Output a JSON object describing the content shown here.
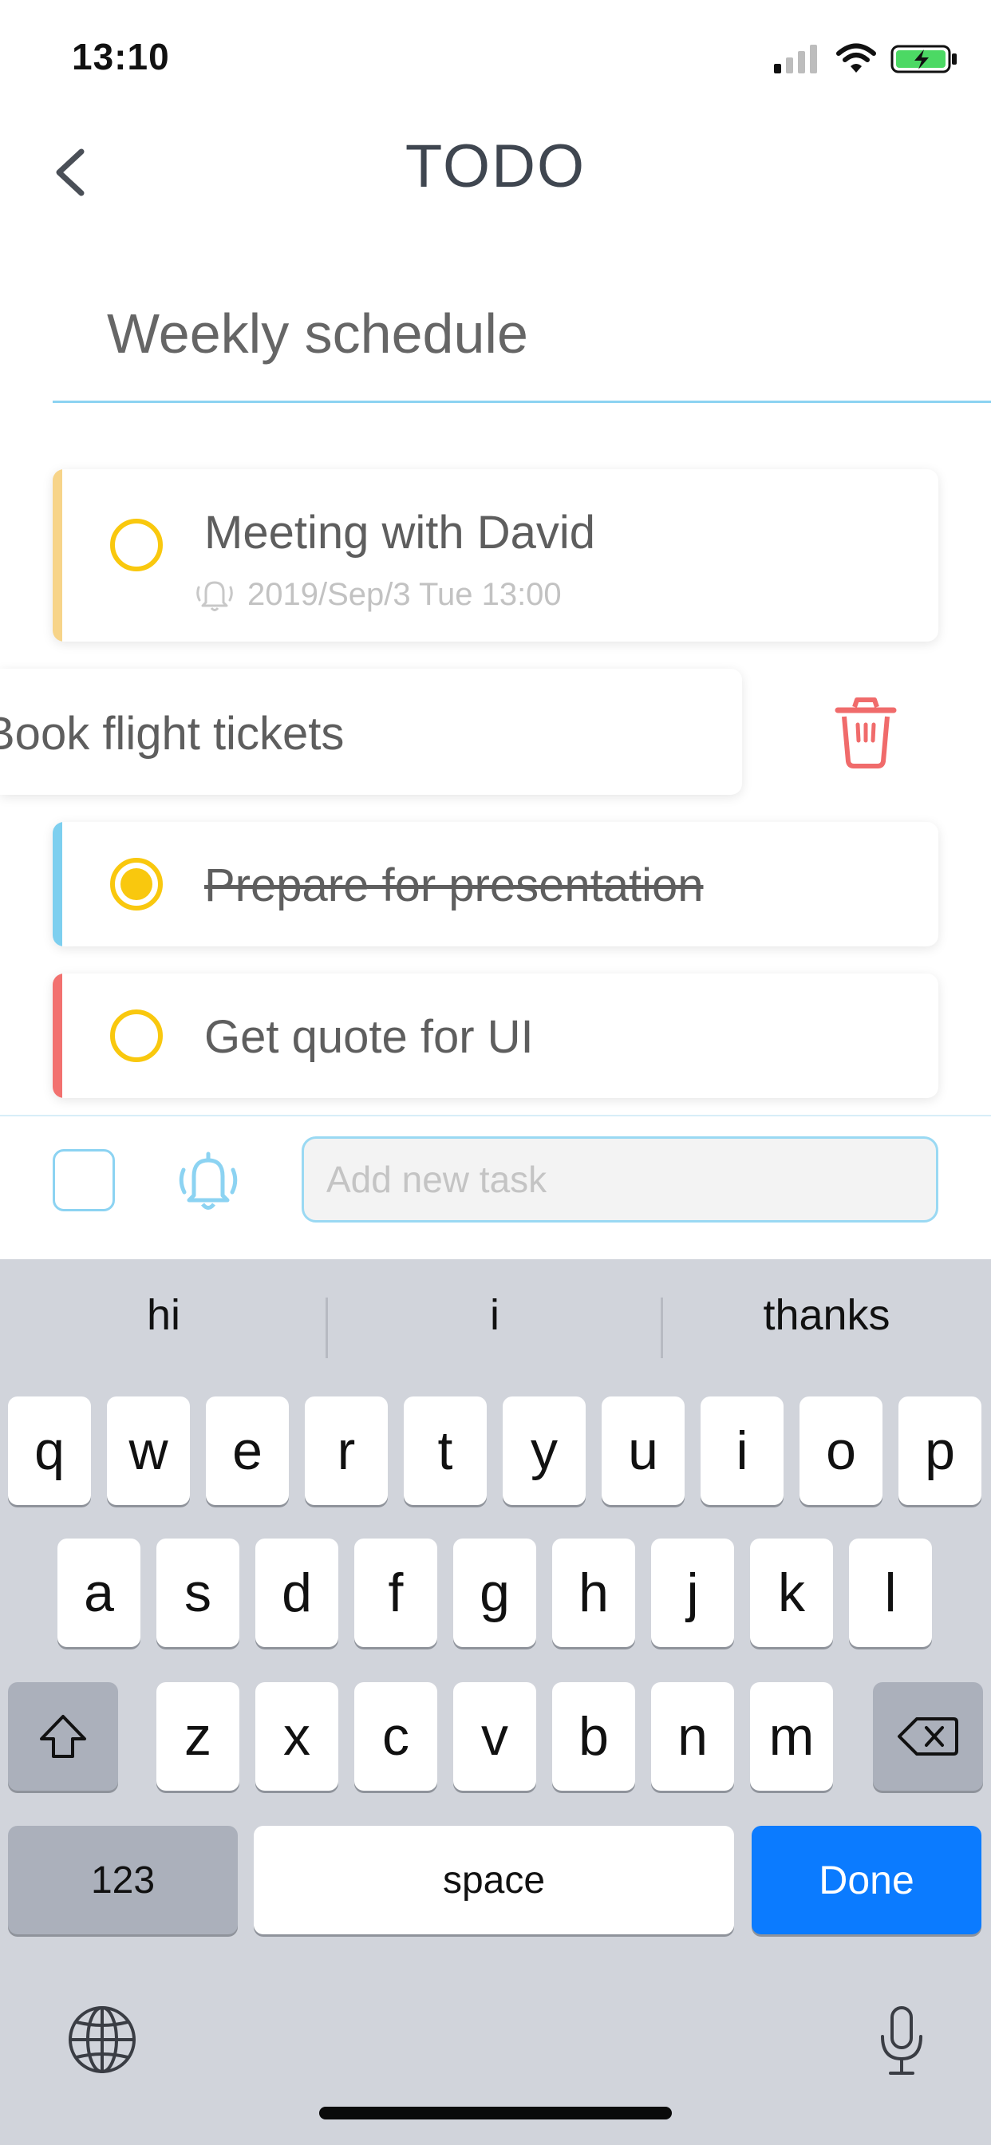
{
  "status_bar": {
    "time": "13:10"
  },
  "nav": {
    "title": "TODO"
  },
  "list": {
    "title": "Weekly schedule"
  },
  "tasks": [
    {
      "text": "Meeting with David",
      "reminder": "2019/Sep/3 Tue 13:00",
      "color": "#f7d489",
      "done": false
    },
    {
      "text": "Book flight tickets",
      "swiped": true
    },
    {
      "text": "Prepare for presentation",
      "color": "#7dcfef",
      "done": true
    },
    {
      "text": "Get quote for UI",
      "color": "#f2716f",
      "done": false
    }
  ],
  "input": {
    "placeholder": "Add new task"
  },
  "keyboard": {
    "suggestions": [
      "hi",
      "i",
      "thanks"
    ],
    "row1": [
      "q",
      "w",
      "e",
      "r",
      "t",
      "y",
      "u",
      "i",
      "o",
      "p"
    ],
    "row2": [
      "a",
      "s",
      "d",
      "f",
      "g",
      "h",
      "j",
      "k",
      "l"
    ],
    "row3": [
      "z",
      "x",
      "c",
      "v",
      "b",
      "n",
      "m"
    ],
    "numbers_label": "123",
    "space_label": "space",
    "done_label": "Done"
  },
  "colors": {
    "accent": "#8cd3f2",
    "check": "#f9c80e",
    "delete": "#f06b6b",
    "done_key": "#0b7bff"
  }
}
